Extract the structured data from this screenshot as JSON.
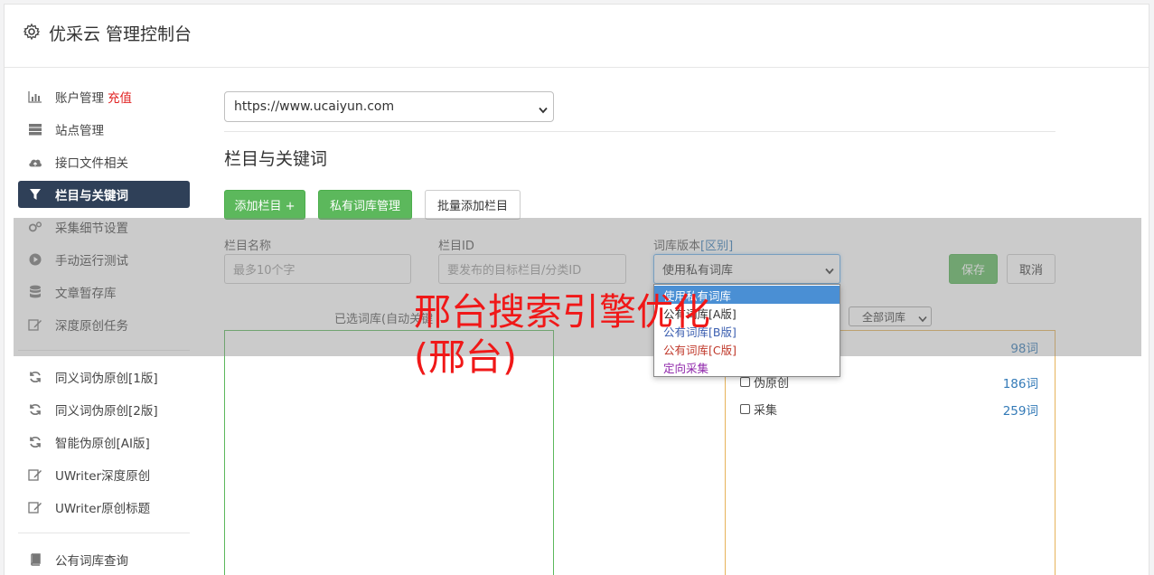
{
  "header": {
    "title": "优采云 管理控制台",
    "icon": "gear-icon"
  },
  "sidebar": {
    "items": [
      {
        "label": "账户管理",
        "extra": "充值",
        "icon": "bar-chart-icon"
      },
      {
        "label": "站点管理",
        "icon": "server-icon"
      },
      {
        "label": "接口文件相关",
        "icon": "cloud-upload-icon"
      },
      {
        "label": "栏目与关键词",
        "icon": "filter-icon",
        "active": true
      },
      {
        "label": "采集细节设置",
        "icon": "gears-icon"
      },
      {
        "label": "手动运行测试",
        "icon": "play-icon"
      },
      {
        "label": "文章暂存库",
        "icon": "database-icon"
      },
      {
        "label": "深度原创任务",
        "icon": "edit-icon"
      }
    ],
    "items2": [
      {
        "label": "同义词伪原创[1版]",
        "icon": "refresh-icon"
      },
      {
        "label": "同义词伪原创[2版]",
        "icon": "refresh-icon"
      },
      {
        "label": "智能伪原创[AI版]",
        "icon": "refresh-icon"
      },
      {
        "label": "UWriter深度原创",
        "icon": "edit-icon"
      },
      {
        "label": "UWriter原创标题",
        "icon": "edit-icon"
      }
    ],
    "items3": [
      {
        "label": "公有词库查询",
        "icon": "book-icon"
      }
    ]
  },
  "main": {
    "site_select": {
      "value": "https://www.ucaiyun.com"
    },
    "section_title": "栏目与关键词",
    "buttons": {
      "add_column": "添加栏目 +",
      "private_lib": "私有词库管理",
      "batch_add": "批量添加栏目"
    },
    "form": {
      "name_label": "栏目名称",
      "name_placeholder": "最多10个字",
      "id_label": "栏目ID",
      "id_placeholder": "要发布的目标栏目/分类ID",
      "version_label": "词库版本",
      "version_link": "[区别]",
      "version_value": "使用私有词库",
      "save": "保存",
      "cancel": "取消"
    },
    "dropdown_options": [
      {
        "label": "使用私有词库",
        "color": "#ffffff",
        "bg": "#4a8fd4"
      },
      {
        "label": "公有词库[A版]",
        "color": "#333333"
      },
      {
        "label": "公有词库[B版]",
        "color": "#3c5fb0"
      },
      {
        "label": "公有词库[C版]",
        "color": "#c0392b"
      },
      {
        "label": "定向采集",
        "color": "#8e24aa"
      }
    ],
    "selected_label": "已选词库(自动关键",
    "all_libs_select": "全部词库",
    "libraries": [
      {
        "name": "",
        "count": "98词"
      },
      {
        "name": "伪原创",
        "count": "186词"
      },
      {
        "name": "采集",
        "count": "259词"
      }
    ]
  },
  "watermark": "邢台搜索引擎优化(邢台)",
  "colors": {
    "accent_green": "#5cb85c",
    "active_nav": "#2f4058",
    "link": "#337ab7",
    "watermark": "#f01818"
  }
}
